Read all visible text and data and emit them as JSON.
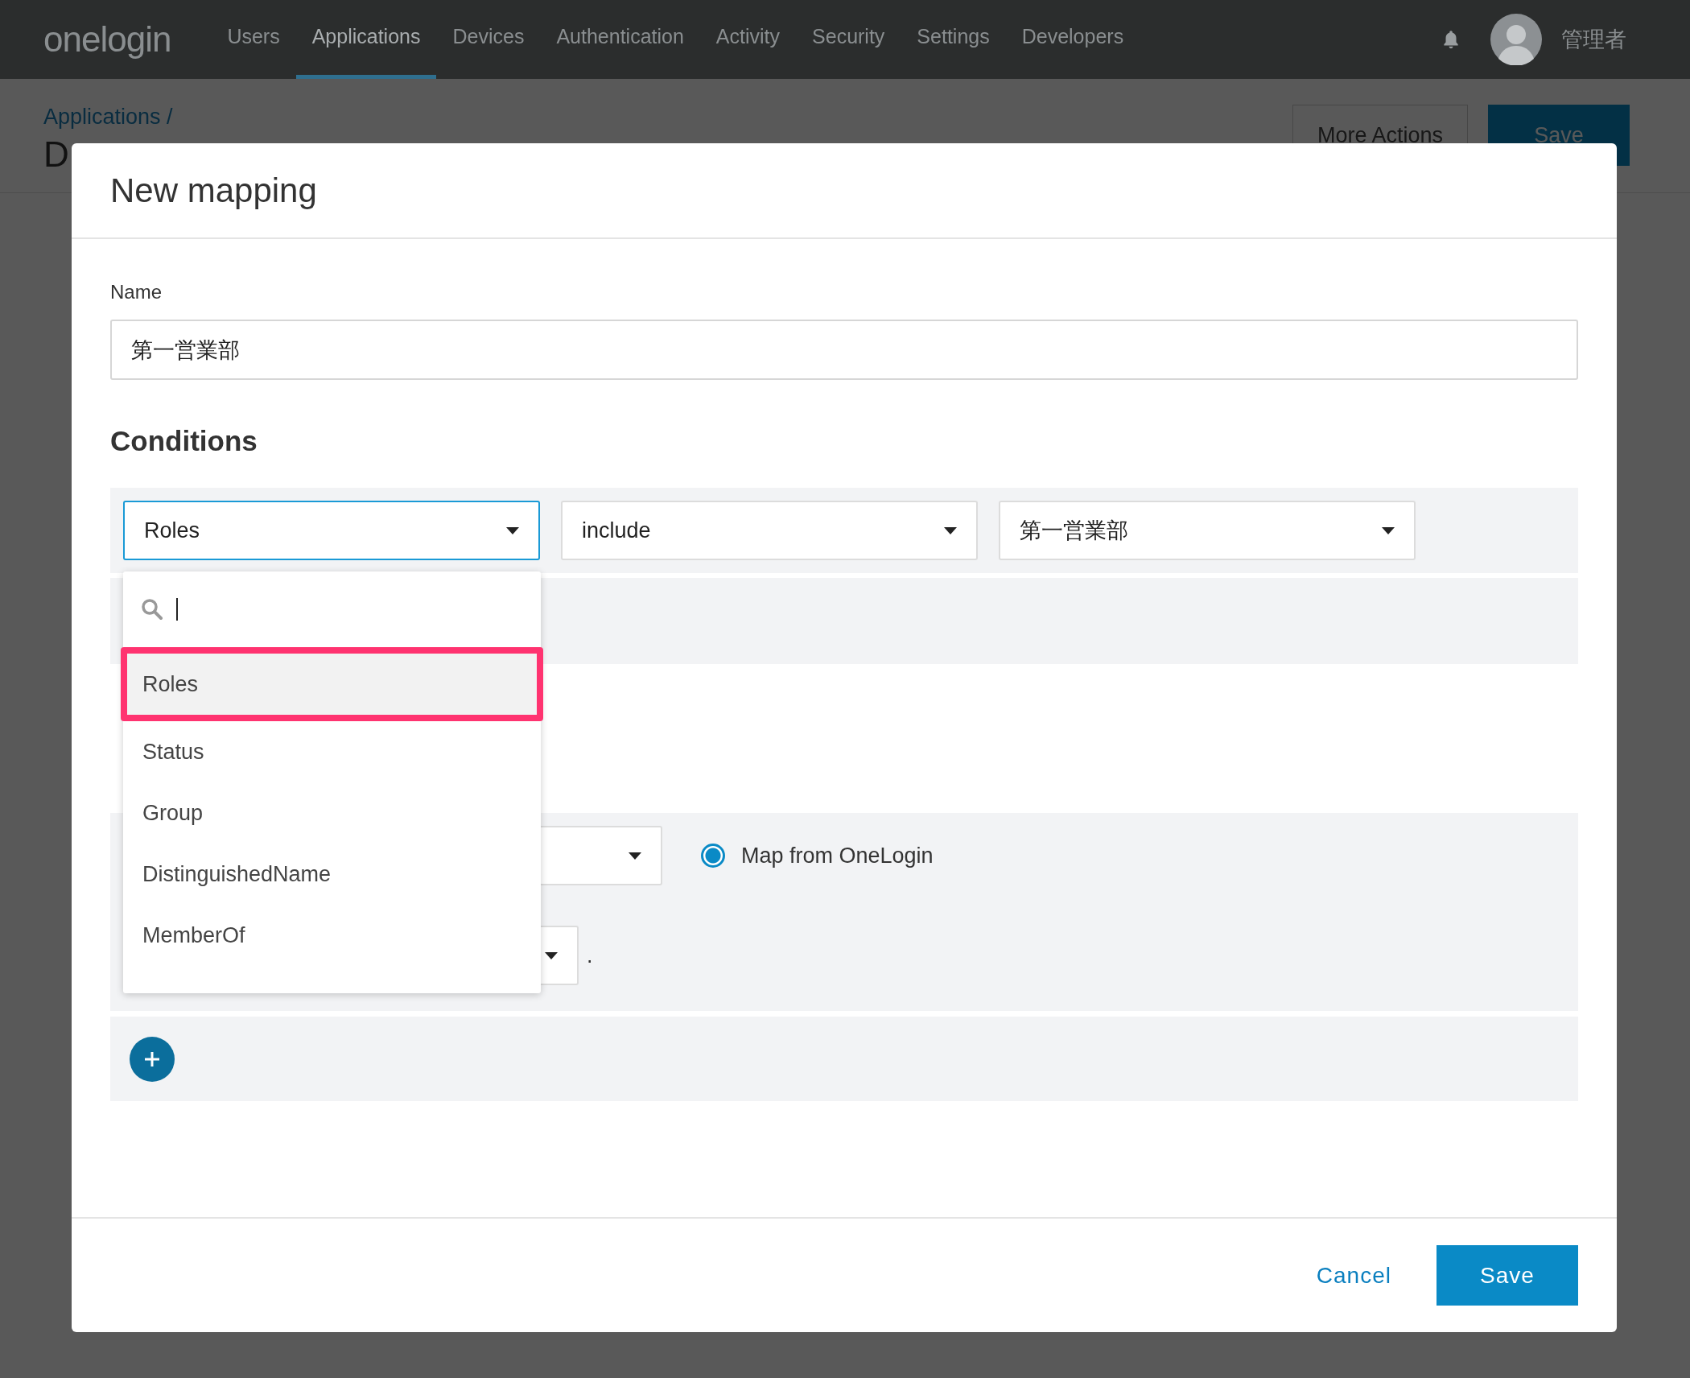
{
  "nav": {
    "logo": "onelogin",
    "items": [
      {
        "label": "Users",
        "selected": false
      },
      {
        "label": "Applications",
        "selected": true
      },
      {
        "label": "Devices",
        "selected": false
      },
      {
        "label": "Authentication",
        "selected": false
      },
      {
        "label": "Activity",
        "selected": false
      },
      {
        "label": "Security",
        "selected": false
      },
      {
        "label": "Settings",
        "selected": false
      },
      {
        "label": "Developers",
        "selected": false
      }
    ],
    "user": "管理者"
  },
  "page": {
    "breadcrumb": "Applications /",
    "title": "D",
    "more_actions": "More Actions",
    "save": "Save"
  },
  "modal": {
    "title": "New mapping",
    "name_label": "Name",
    "name_value": "第一営業部",
    "conditions_heading": "Conditions",
    "condition": {
      "field": "Roles",
      "operator": "include",
      "value": "第一営業部"
    },
    "dropdown": {
      "options": [
        {
          "label": "Roles",
          "selected": true
        },
        {
          "label": "Status",
          "selected": false
        },
        {
          "label": "Group",
          "selected": false
        },
        {
          "label": "DistinguishedName",
          "selected": false
        },
        {
          "label": "MemberOf",
          "selected": false
        }
      ]
    },
    "radio": {
      "label": "Map from OneLogin",
      "selected": true
    },
    "row_suffix": ".",
    "cancel": "Cancel",
    "save": "Save"
  }
}
